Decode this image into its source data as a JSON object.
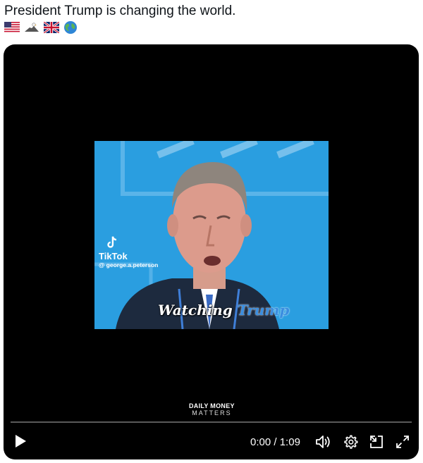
{
  "tweet": {
    "text": "President Trump is changing the world.",
    "emojis": [
      "us-flag",
      "eagle",
      "uk-flag",
      "globe"
    ]
  },
  "video": {
    "overlay_brand": "TikTok",
    "overlay_handle": "@ george.a.peterson",
    "caption_prefix": "Watching ",
    "caption_highlight": "Trump",
    "watermark_line1": "DAILY MONEY",
    "watermark_line2": "MATTERS",
    "current_time": "0:00",
    "time_separator": " / ",
    "duration": "1:09",
    "progress": 0.0
  },
  "colors": {
    "player_background": "#000000",
    "video_background": "#1f9be0",
    "caption_highlight": "#3a8ee0"
  },
  "icons": [
    "play-icon",
    "volume-icon",
    "settings-icon",
    "minimize-icon",
    "fullscreen-icon"
  ]
}
